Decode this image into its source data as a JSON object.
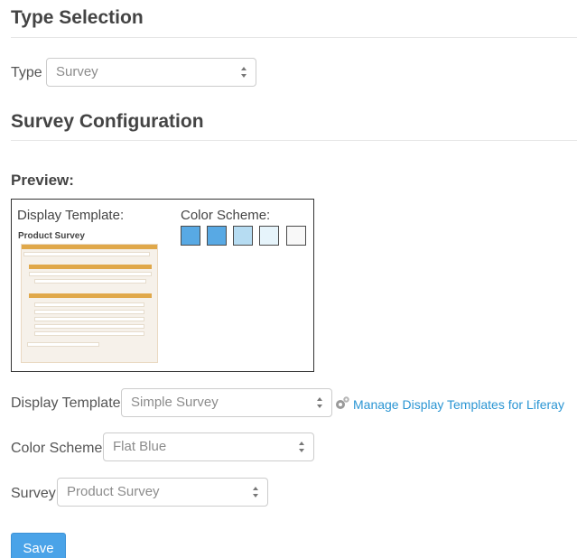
{
  "type_selection": {
    "heading": "Type Selection",
    "type_label": "Type",
    "type_value": "Survey"
  },
  "survey_configuration": {
    "heading": "Survey Configuration",
    "preview_label": "Preview:",
    "preview": {
      "display_template_label": "Display Template:",
      "color_scheme_label": "Color Scheme:",
      "thumbnail_title": "Product Survey",
      "swatches": [
        "#58a9e4",
        "#58a9e4",
        "#b6dcf2",
        "#e6f4fb",
        "#f8f8f8"
      ]
    },
    "display_template": {
      "label": "Display Template",
      "value": "Simple Survey",
      "manage_link": "Manage Display Templates for Liferay"
    },
    "color_scheme": {
      "label": "Color Scheme",
      "value": "Flat Blue"
    },
    "survey": {
      "label": "Survey",
      "value": "Product Survey"
    }
  },
  "actions": {
    "save_label": "Save"
  },
  "icons": [
    "select-arrows-icon",
    "gear-icon"
  ],
  "colors": {
    "link": "#2a95d3",
    "primary_button": "#4aa3e8",
    "heading": "#444444"
  }
}
